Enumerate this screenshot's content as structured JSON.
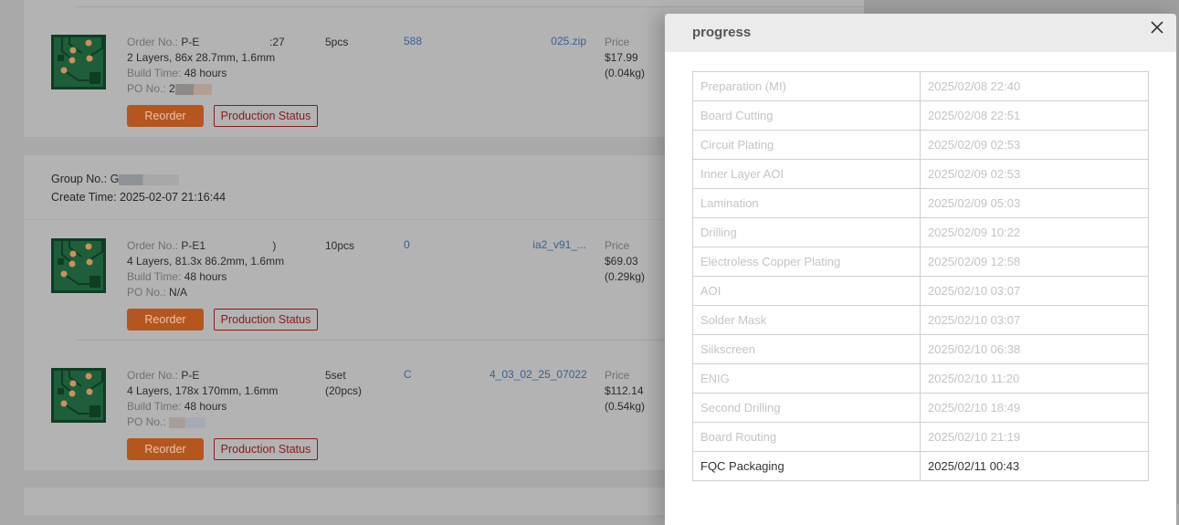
{
  "orders_top": {
    "order_label": "Order No.:",
    "order_no": "P-E                       :27",
    "spec": "2 Layers, 86x 28.7mm, 1.6mm",
    "build_label": "Build Time:",
    "build_time": "48 hours",
    "po_label": "PO No.:",
    "po_no": "2",
    "qty": "5pcs",
    "link1": "588",
    "link2": "025.zip",
    "price_label": "Price",
    "price": "$17.99",
    "weight": "(0.04kg)",
    "reorder": "Reorder",
    "production_status": "Production Status"
  },
  "group": {
    "group_label": "Group No.:",
    "group_no": "G",
    "create_label": "Create Time:",
    "create_time": "2025-02-07 21:16:44",
    "orders": [
      {
        "order_label": "Order No.:",
        "order_no": "P-E1                      )",
        "spec": "4 Layers, 81.3x 86.2mm, 1.6mm",
        "build_label": "Build Time:",
        "build_time": "48 hours",
        "po_label": "PO No.:",
        "po_no": "N/A",
        "qty": "10pcs",
        "qty2": "",
        "link1": "0",
        "link2": "ia2_v91_...",
        "price_label": "Price",
        "price": "$69.03",
        "weight": "(0.29kg)",
        "reorder": "Reorder",
        "production_status": "Production Status"
      },
      {
        "order_label": "Order No.:",
        "order_no": "P-E",
        "spec": "4 Layers, 178x 170mm, 1.6mm",
        "build_label": "Build Time:",
        "build_time": "48 hours",
        "po_label": "PO No.:",
        "po_no": "",
        "qty": "5set",
        "qty2": "(20pcs)",
        "link1": "C",
        "link2": "4_03_02_25_07022...",
        "price_label": "Price",
        "price": "$112.14",
        "weight": "(0.54kg)",
        "reorder": "Reorder",
        "production_status": "Production Status"
      }
    ]
  },
  "modal": {
    "title": "progress",
    "close_icon": "close-icon",
    "steps": [
      {
        "step": "Preparation (MI)",
        "time": "2025/02/08 22:40"
      },
      {
        "step": "Board Cutting",
        "time": "2025/02/08 22:51"
      },
      {
        "step": "Circuit Plating",
        "time": "2025/02/09 02:53"
      },
      {
        "step": "Inner Layer AOI",
        "time": "2025/02/09 02:53"
      },
      {
        "step": "Lamination",
        "time": "2025/02/09 05:03"
      },
      {
        "step": "Drilling",
        "time": "2025/02/09 10:22"
      },
      {
        "step": "Electroless Copper Plating",
        "time": "2025/02/09 12:58"
      },
      {
        "step": "AOI",
        "time": "2025/02/10 03:07"
      },
      {
        "step": "Solder Mask",
        "time": "2025/02/10 03:07"
      },
      {
        "step": "Silkscreen",
        "time": "2025/02/10 06:38"
      },
      {
        "step": "ENIG",
        "time": "2025/02/10 11:20"
      },
      {
        "step": "Second Drilling",
        "time": "2025/02/10 18:49"
      },
      {
        "step": "Board Routing",
        "time": "2025/02/10 21:19"
      },
      {
        "step": "FQC Packaging",
        "time": "2025/02/11 00:43"
      }
    ],
    "current_step": "FQC Packaging"
  },
  "colors": {
    "reorder_bg": "#b5561f",
    "status_border": "#8b1a1a",
    "link": "#3a5f93",
    "pcb_green": "#1e5e3a"
  }
}
